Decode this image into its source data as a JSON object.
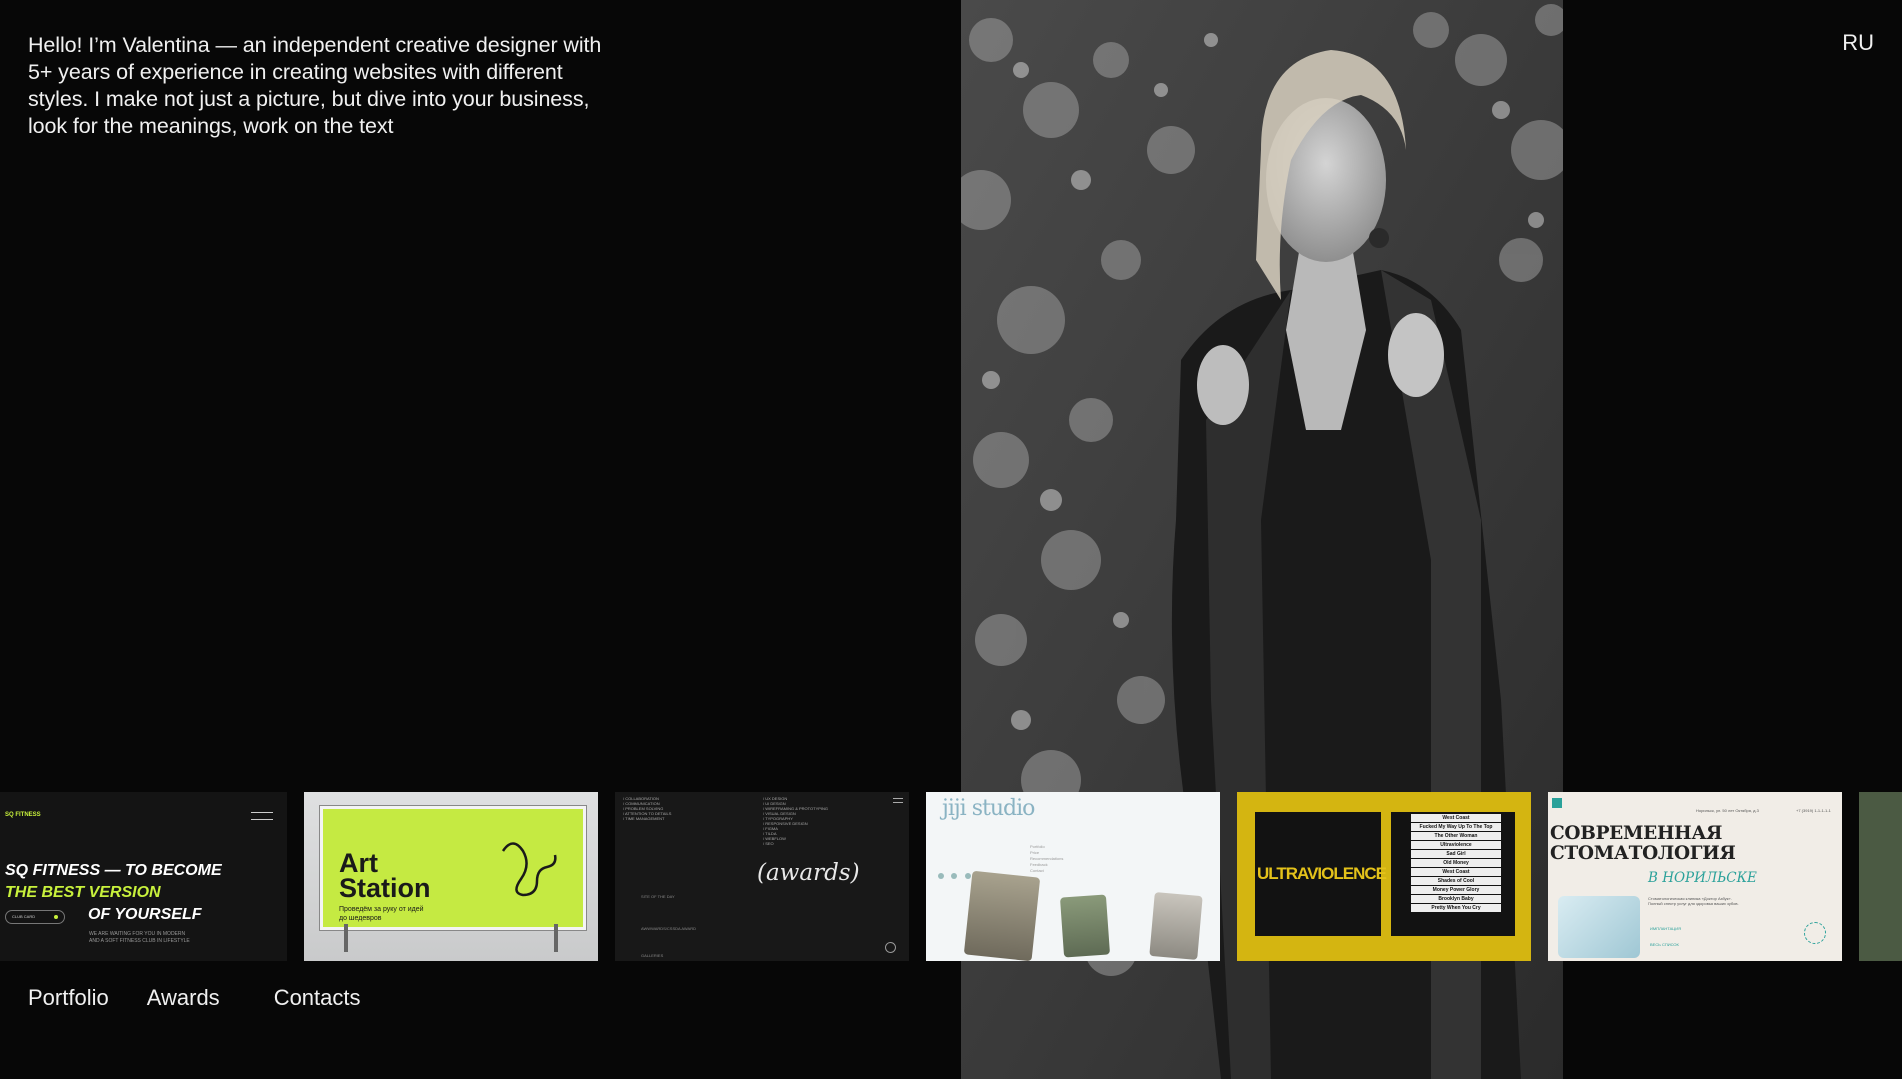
{
  "intro": {
    "text": "Hello! I’m Valentina — an independent creative designer with 5+ years of experience in creating websites with different styles. I make not just a picture, but dive into your business, look for the meanings, work on the text"
  },
  "lang_switch": "RU",
  "nav": [
    "Portfolio",
    "Awards",
    "Contacts"
  ],
  "portfolio": {
    "card1": {
      "tag": "SQ FITNESS",
      "line1": "SQ FITNESS — TO BECOME",
      "line2": "THE BEST  VERSION",
      "line3": "OF YOURSELF",
      "button": "CLUB CARD",
      "sub": "WE ARE WAITING FOR YOU IN MODERN\nAND A SOFT FITNESS CLUB IN LIFESTYLE"
    },
    "card2": {
      "title1": "Art",
      "title2": "Station",
      "ru_text": "Проведём за руку от идей\nдо шедевров"
    },
    "card3": {
      "heading": "(awards)",
      "list_left": "/ COLLABORATION\n/ COMMUNICATION\n/ PROBLEM SOLVING\n/ ATTENTION TO DETAILS\n/ TIME MANAGEMENT",
      "list_right": "/ UX DESIGN\n/ UI DESIGN\n/ WIREFRAMING & PROTOTYPING\n/ VISUAL DESIGN\n/ TYPOGRAPHY\n/ RESPONSIVE DESIGN\n/ FIGMA\n/ TILDA\n/ WEBFLOW\n/ SEO",
      "row1": "SITE OF THE DAY",
      "row2": "AWWWARDS/CSSDA AWARD",
      "row3": "GALLERIES"
    },
    "card4": {
      "logo": "jiji studio",
      "nav": "Portfolio\nPrice\nRecommendations\nFeedback\nContact"
    },
    "card5": {
      "title": "ULTRAVIOLENCE",
      "tracks": [
        "West Coast",
        "Fucked My Way Up To The Top",
        "The Other Woman",
        "Ultraviolence",
        "Sad Girl",
        "Old Money",
        "West Coast",
        "Shades of Cool",
        "Money Power Glory",
        "Brooklyn Baby",
        "Pretty When You Cry"
      ]
    },
    "card6": {
      "title": "СОВРЕМЕННАЯ\nСТОМАТОЛОГИЯ",
      "subtitle": "В НОРИЛЬСКЕ",
      "desc": "Стоматологическая клиника «Доктор Азбук».\nПолный спектр услуг для здоровья ваших зубов.",
      "address": "Норильск, ул. 50 лет Октября, д.3",
      "phone": "+7 (3919) 1-1-1-1-1",
      "link1": "ИМПЛАНТАЦИЯ",
      "link2": "ВЕСЬ СПИСОК"
    }
  },
  "colors": {
    "background": "#070707",
    "accent_green": "#c8f13c",
    "ultraviolence_yellow": "#d4b511",
    "dental_teal": "#2aa19a"
  }
}
